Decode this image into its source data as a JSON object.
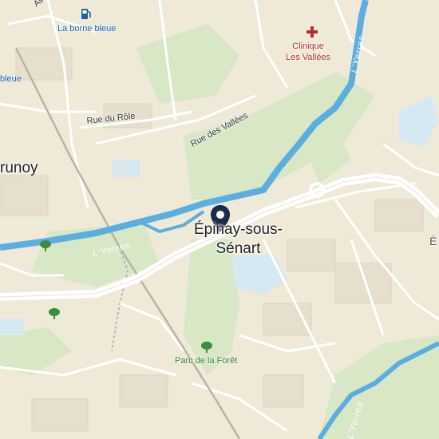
{
  "map": {
    "places": {
      "city_main_line1": "Épinay-sous-",
      "city_main_line2": "Sénart",
      "city_west": "Brunoy",
      "city_west_visible": "runoy",
      "city_east_partial": "É"
    },
    "streets": {
      "rue_du_role": "Rue du Rôle",
      "rue_des_vallees": "Rue des Vallées",
      "avenue_partial": "Ave"
    },
    "rivers": {
      "river_1": "L'Yerres",
      "river_2": "L'Yerres",
      "river_3": "L'Yerres",
      "river_4": "L'Yerres"
    },
    "pois": {
      "fuel_station": "La borne bleue",
      "fuel_partial": "bleue",
      "clinic_line1": "Clinique",
      "clinic_line2": "Les Vallées",
      "park": "Parc de la Forêt"
    },
    "icons": {
      "pin": "location-pin-icon",
      "fuel": "fuel-pump-icon",
      "hospital": "red-cross-icon",
      "park": "tree-icon"
    },
    "colors": {
      "land": "#efe9d8",
      "park": "#d6e6c3",
      "river": "#5aaee0",
      "road": "#ffffff",
      "pin": "#1c2b4a",
      "water_pool": "#cfe6f2"
    }
  }
}
